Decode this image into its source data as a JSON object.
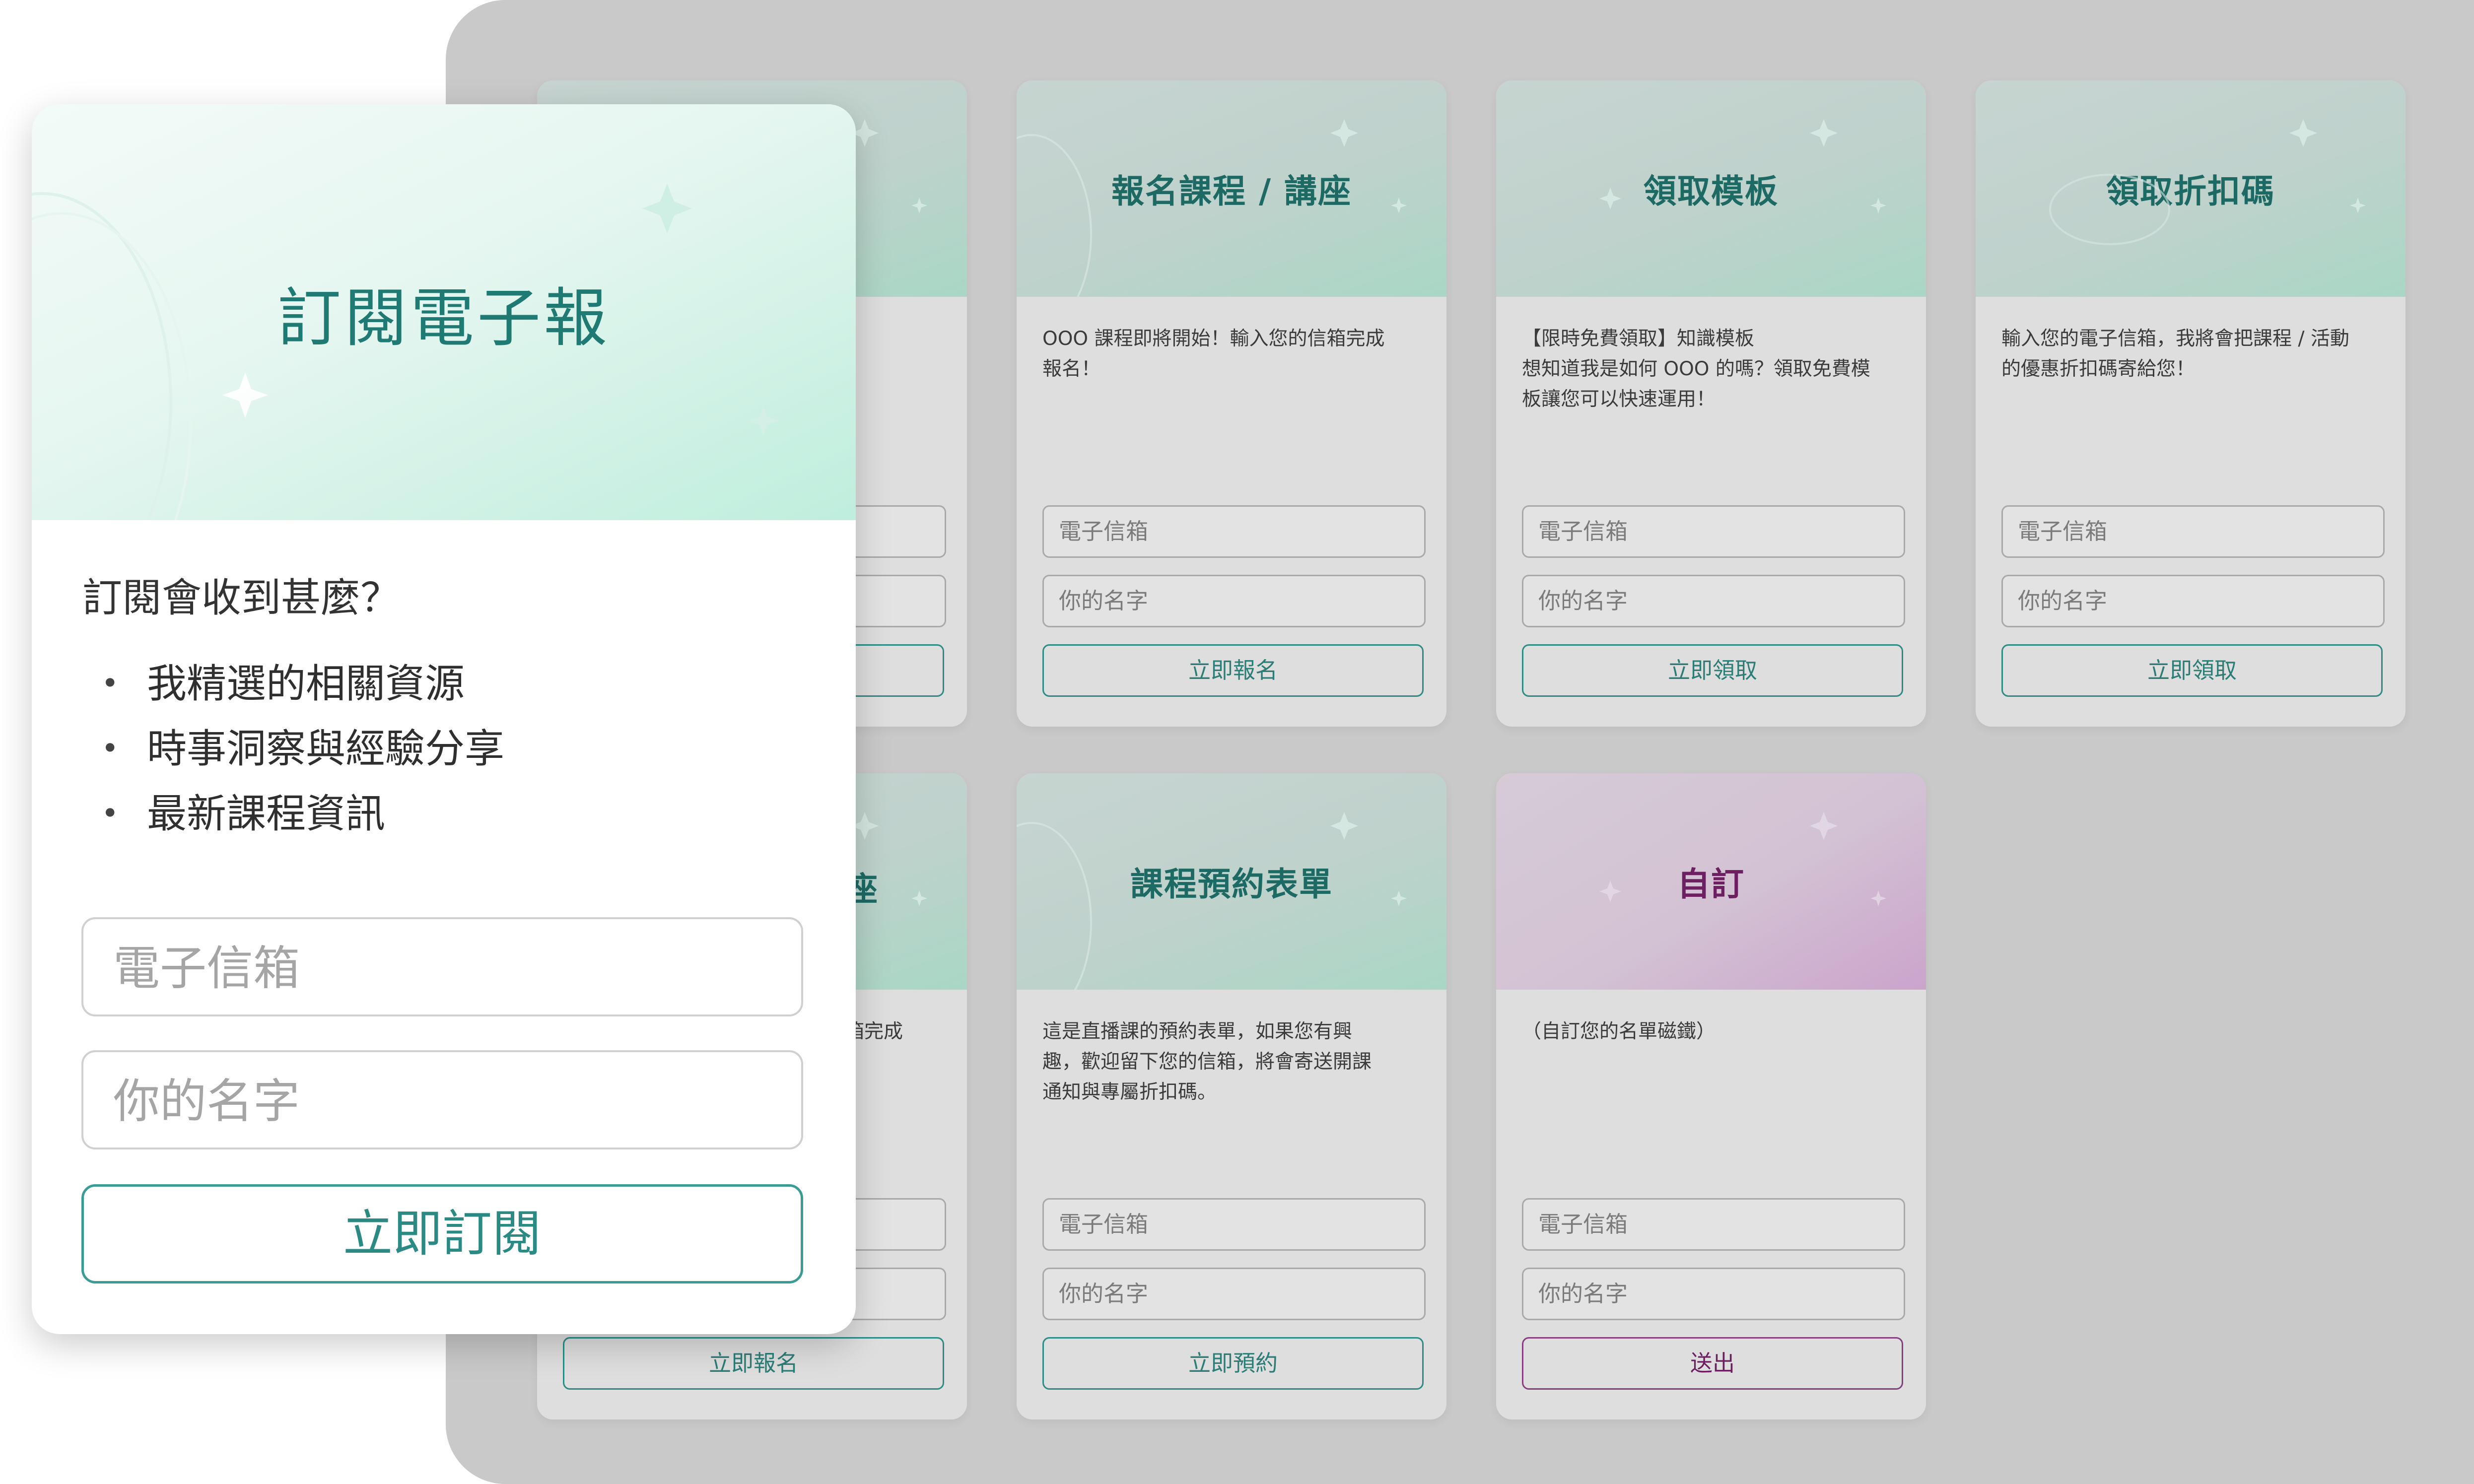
{
  "gallery": {
    "cards": [
      {
        "title": "",
        "description": "",
        "email_placeholder": "",
        "name_placeholder": "",
        "button": ""
      },
      {
        "title": "報名課程 / 講座",
        "description": "OOO 課程即將開始！輸入您的信箱完成\n報名！",
        "email_placeholder": "電子信箱",
        "name_placeholder": "你的名字",
        "button": "立即報名"
      },
      {
        "title": "領取模板",
        "description": "【限時免費領取】知識模板\n想知道我是如何 OOO 的嗎？領取免費模\n板讓您可以快速運用！",
        "email_placeholder": "電子信箱",
        "name_placeholder": "你的名字",
        "button": "立即領取"
      },
      {
        "title": "領取折扣碼",
        "description": "輸入您的電子信箱，我將會把課程 / 活動\n的優惠折扣碼寄給您！",
        "email_placeholder": "電子信箱",
        "name_placeholder": "你的名字",
        "button": "立即領取"
      },
      {
        "title": "座",
        "description": "箱完成",
        "email_placeholder": "",
        "name_placeholder": "",
        "button": "立即報名"
      },
      {
        "title": "課程預約表單",
        "description": "這是直播課的預約表單，如果您有興\n趣，歡迎留下您的信箱，將會寄送開課\n通知與專屬折扣碼。",
        "email_placeholder": "電子信箱",
        "name_placeholder": "你的名字",
        "button": "立即預約"
      },
      {
        "title": "自訂",
        "description": "（自訂您的名單磁鐵）",
        "email_placeholder": "電子信箱",
        "name_placeholder": "你的名字",
        "button": "送出",
        "accent": "#6e1f61"
      }
    ]
  },
  "subscribe_card": {
    "title": "訂閱電子報",
    "question": "訂閱會收到甚麼？",
    "benefits": [
      "我精選的相關資源",
      "時事洞察與經驗分享",
      "最新課程資訊"
    ],
    "email_placeholder": "電子信箱",
    "name_placeholder": "你的名字",
    "button": "立即訂閱"
  },
  "colors": {
    "teal_accent": "#1f7a74",
    "purple_accent": "#6e1f61",
    "backdrop": "#c9c9c9"
  }
}
